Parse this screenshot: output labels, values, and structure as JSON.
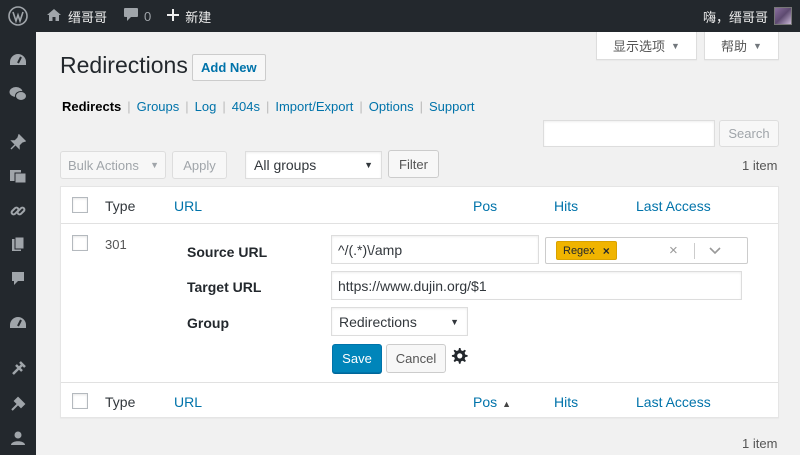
{
  "adminbar": {
    "site_name": "缙哥哥",
    "comment_count": "0",
    "new_label": "新建",
    "greeting": "嗨，缙哥哥",
    "icons": [
      "wordpress-icon",
      "home-icon",
      "comment-icon",
      "plus-icon",
      "avatar"
    ]
  },
  "sidebar": {
    "icons": [
      "dashboard-icon",
      "wechat-icon",
      "pin-icon",
      "media-icon",
      "link-icon",
      "pages-icon",
      "comments-icon",
      "appearance-icon",
      "plugins-icon",
      "tools-icon",
      "users-icon"
    ]
  },
  "screen_options": {
    "label": "显示选项"
  },
  "help": {
    "label": "帮助"
  },
  "page": {
    "title": "Redirections",
    "add_new": "Add New"
  },
  "subnav": {
    "current": "Redirects",
    "groups": "Groups",
    "log": "Log",
    "e404s": "404s",
    "import_export": "Import/Export",
    "options": "Options",
    "support": "Support",
    "separator": "|"
  },
  "search": {
    "button": "Search",
    "value": ""
  },
  "tablenav": {
    "bulk_actions": "Bulk Actions",
    "apply": "Apply",
    "group_filter": "All groups",
    "filter": "Filter",
    "item_count": "1 item"
  },
  "table": {
    "columns": {
      "type": "Type",
      "url": "URL",
      "pos": "Pos",
      "hits": "Hits",
      "last_access": "Last Access"
    },
    "row": {
      "type": "301",
      "source_label": "Source URL",
      "source_value": "^/(.*)\\/amp",
      "source_tag": "Regex",
      "tag_remove": "×",
      "clear": "×",
      "target_label": "Target URL",
      "target_value": "https://www.dujin.org/$1",
      "group_label": "Group",
      "group_value": "Redirections",
      "save": "Save",
      "cancel": "Cancel"
    }
  },
  "footer": {
    "item_count": "1 item"
  },
  "colors": {
    "primary": "#0085ba",
    "link": "#0073aa",
    "tag": "#f0b400",
    "adminbar": "#23282d"
  }
}
